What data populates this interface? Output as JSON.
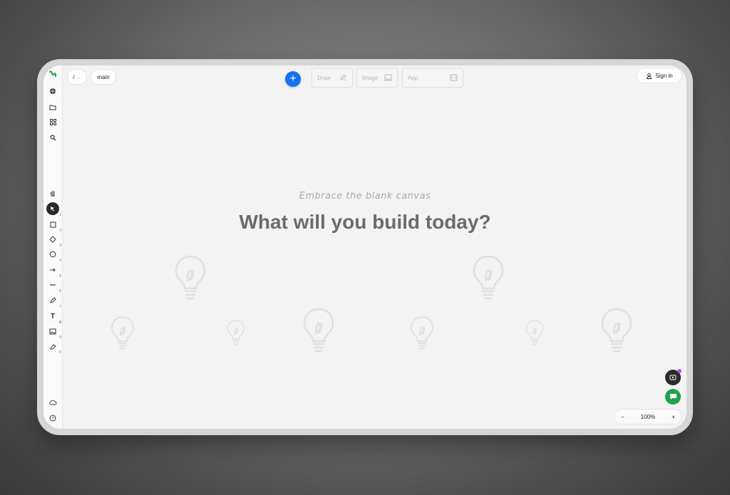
{
  "topbar": {
    "path_label": "/",
    "branch_label": "main",
    "modes": [
      {
        "label": "Draw",
        "icon": "pen-icon"
      },
      {
        "label": "Image",
        "icon": "image-icon"
      },
      {
        "label": "App",
        "icon": "code-icon"
      }
    ],
    "sign_in_label": "Sign in"
  },
  "sidebar": {
    "top_icons": [
      "globe-icon",
      "folder-icon",
      "grid-icon",
      "search-icon"
    ],
    "tools": [
      {
        "name": "hand",
        "num": ""
      },
      {
        "name": "select",
        "num": "1"
      },
      {
        "name": "rectangle",
        "num": "2"
      },
      {
        "name": "diamond",
        "num": "3"
      },
      {
        "name": "ellipse",
        "num": "4"
      },
      {
        "name": "arrow",
        "num": "5"
      },
      {
        "name": "line",
        "num": "6"
      },
      {
        "name": "draw",
        "num": "7"
      },
      {
        "name": "text",
        "num": "8"
      },
      {
        "name": "image",
        "num": "9"
      },
      {
        "name": "eraser",
        "num": "0"
      }
    ],
    "bottom_icons": [
      "cloud-icon",
      "help-icon"
    ]
  },
  "canvas": {
    "tagline": "Embrace the blank canvas",
    "headline": "What will you build today?"
  },
  "zoom": {
    "minus": "−",
    "level": "100%",
    "plus": "+"
  },
  "colors": {
    "accent": "#1573f0",
    "chat": "#1fa34a",
    "notify": "#a855f7"
  }
}
